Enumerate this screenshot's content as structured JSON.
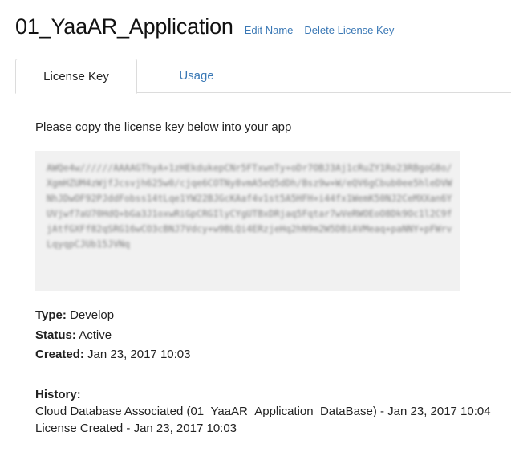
{
  "header": {
    "app_name": "01_YaaAR_Application",
    "edit_name_label": "Edit Name",
    "delete_key_label": "Delete License Key"
  },
  "tabs": [
    {
      "label": "License Key",
      "active": true
    },
    {
      "label": "Usage",
      "active": false
    }
  ],
  "license": {
    "instruction": "Please copy the license key below into your app",
    "key_text": "AWQe4w//////AAAAGThyA+1zHEkdukepCNr5FTxwnTy+oDr7OBJ3Aj1cRuZY1Ro23RBgoG8o/XgmHZUM4zWjfJcsvjh625w0/cjqe6COTNy8vmA5eQ5dDh/Bsz9w+W/eQV6gCbub0ee5hleDVWNhJDwOF92PJddFobss14tLqe1YW22BJGcKAaf4v1st5A5HFH+i44fx1WemK50NJ2CeMXXan6YUVjwf7aU70HdQ+bGa3J1oxwRiGpCRGIlyCYgUTBxDRjaq5Fqtar7wVeRWOEoO8Dk9Oc1l2C9fjAtfGXFf82qSRG16wCO3cBNJ7Vdcy+w9BLQi4ERzjeHq2hN9m2W5DBiAVMeaq+paNNY+pFWrvLqyqpCJUb15JVNq"
  },
  "details": {
    "type_label": "Type:",
    "type_value": "Develop",
    "status_label": "Status:",
    "status_value": "Active",
    "created_label": "Created:",
    "created_value": "Jan 23, 2017 10:03"
  },
  "history": {
    "label": "History:",
    "entries": [
      "Cloud Database Associated (01_YaaAR_Application_DataBase) - Jan 23, 2017 10:04",
      "License Created - Jan 23, 2017 10:03"
    ]
  },
  "colors": {
    "link": "#3a78b5",
    "key_box_bg": "#f1f1f1",
    "text": "#222222"
  }
}
